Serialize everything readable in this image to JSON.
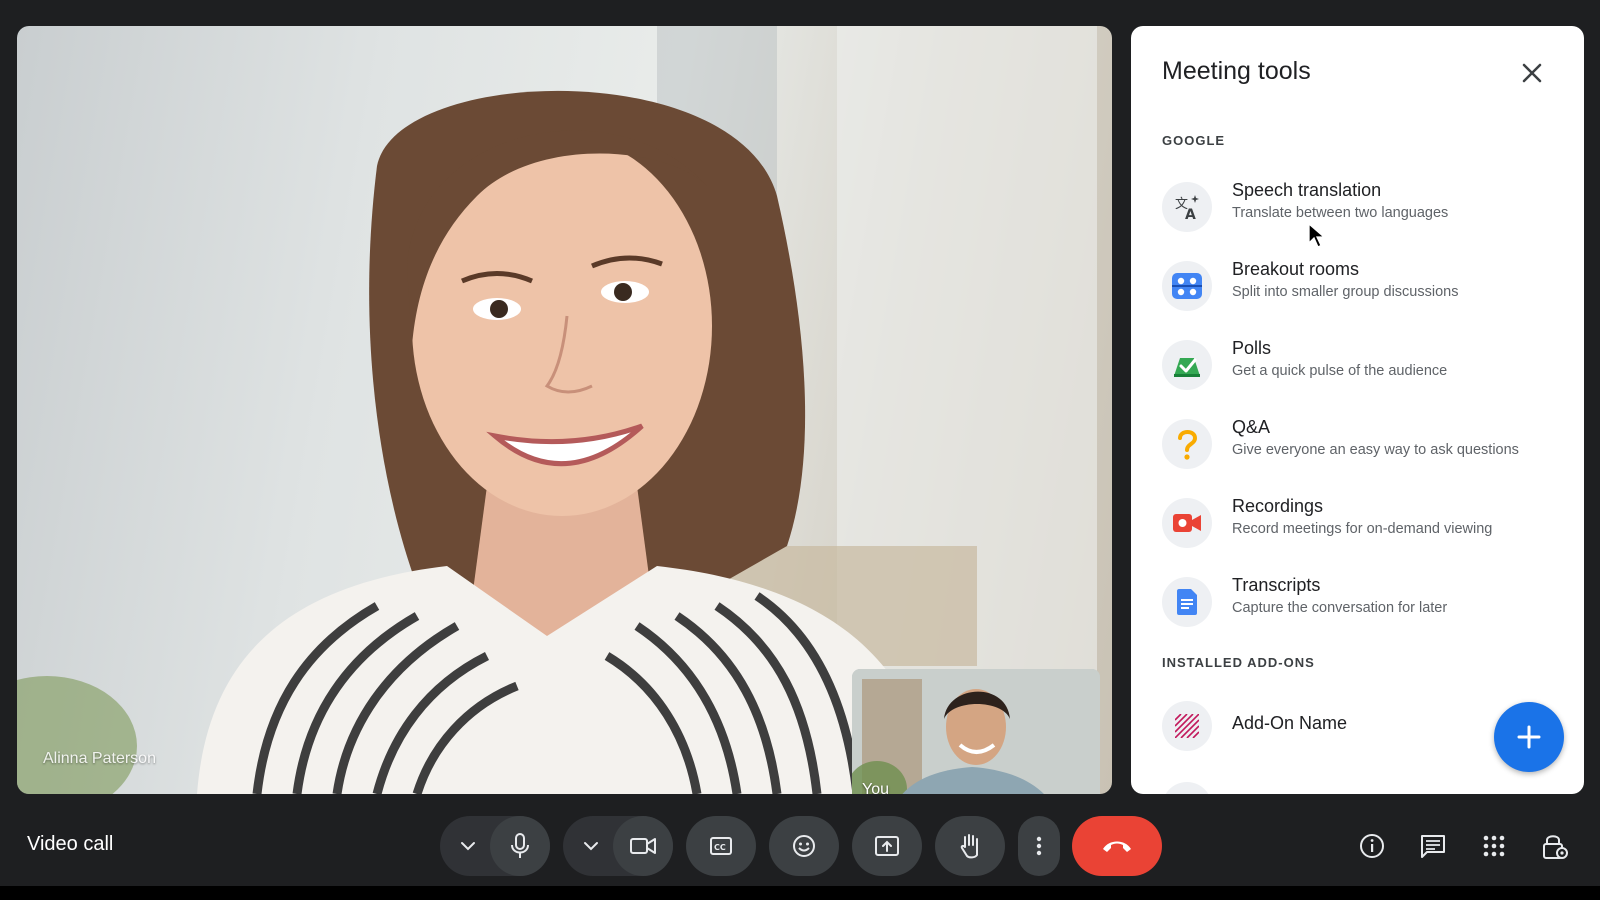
{
  "main_video": {
    "participant_name": "Alinna Paterson",
    "self_label": "You"
  },
  "panel": {
    "title": "Meeting tools",
    "close_icon": "close-icon",
    "google_section_label": "GOOGLE",
    "tools": [
      {
        "name": "Speech translation",
        "description": "Translate between two languages",
        "icon": "translate-icon"
      },
      {
        "name": "Breakout rooms",
        "description": "Split into smaller group discussions",
        "icon": "breakout-rooms-icon"
      },
      {
        "name": "Polls",
        "description": "Get a quick pulse of the audience",
        "icon": "polls-icon"
      },
      {
        "name": "Q&A",
        "description": "Give everyone an easy way to ask questions",
        "icon": "question-icon"
      },
      {
        "name": "Recordings",
        "description": "Record meetings for on-demand viewing",
        "icon": "recording-icon"
      },
      {
        "name": "Transcripts",
        "description": "Capture the conversation for later",
        "icon": "transcript-icon"
      }
    ],
    "addons_section_label": "INSTALLED ADD-ONS",
    "addons": [
      {
        "name": "Add-On Name",
        "icon": "addon-icon"
      }
    ],
    "fab_icon": "plus-icon"
  },
  "bottom_bar": {
    "call_title": "Video call",
    "controls": [
      "chevron-down-icon",
      "microphone-icon",
      "chevron-down-icon",
      "camera-icon",
      "captions-icon",
      "emoji-icon",
      "present-icon",
      "raise-hand-icon",
      "more-vert-icon",
      "end-call-icon"
    ],
    "right_icons": [
      "info-icon",
      "chat-icon",
      "apps-icon",
      "host-controls-icon"
    ]
  },
  "colors": {
    "app_background": "#1e1f21",
    "control_background": "#3c4043",
    "end_call": "#ea4335",
    "fab": "#1a73e8",
    "panel_background": "#ffffff"
  }
}
